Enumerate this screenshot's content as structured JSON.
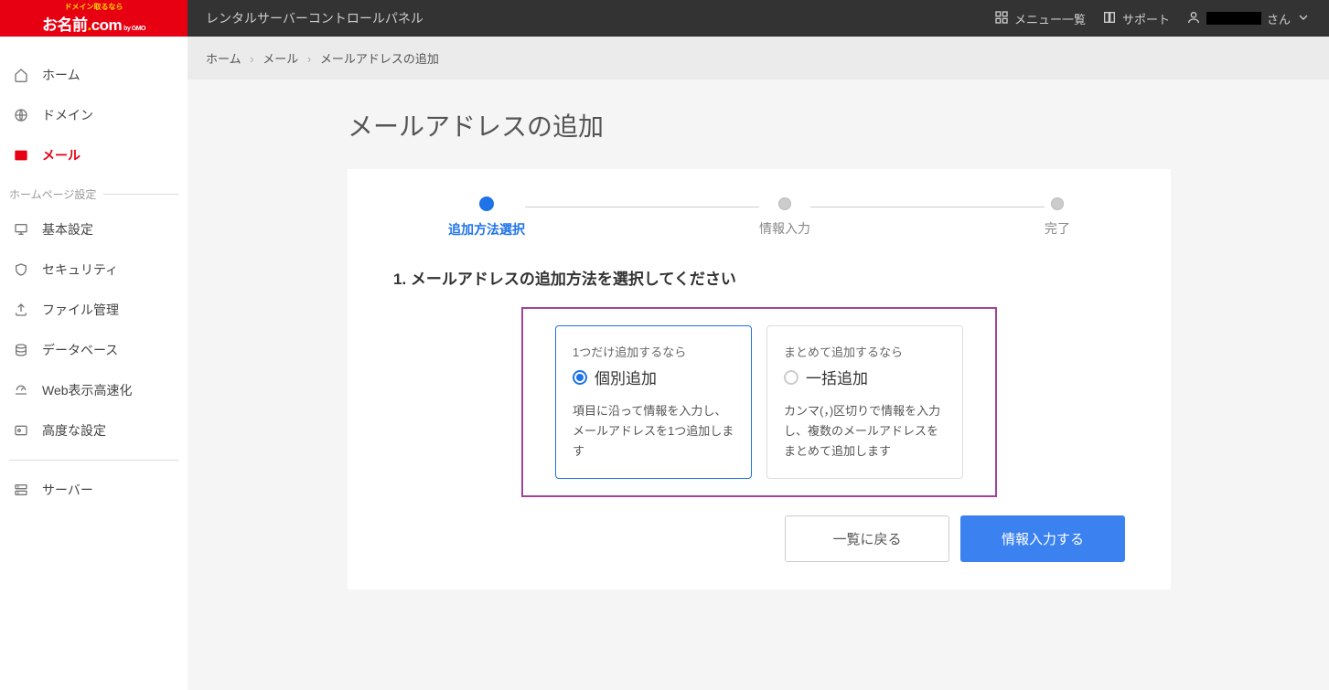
{
  "header": {
    "title": "レンタルサーバーコントロールパネル",
    "menu_list": "メニュー一覧",
    "support": "サポート",
    "user_suffix": "さん"
  },
  "sidebar": {
    "home": "ホーム",
    "domain": "ドメイン",
    "mail": "メール",
    "section_homepage": "ホームページ設定",
    "basic": "基本設定",
    "security": "セキュリティ",
    "file": "ファイル管理",
    "database": "データベース",
    "speed": "Web表示高速化",
    "advanced": "高度な設定",
    "server": "サーバー"
  },
  "breadcrumbs": {
    "home": "ホーム",
    "mail": "メール",
    "current": "メールアドレスの追加"
  },
  "page": {
    "title": "メールアドレスの追加"
  },
  "stepper": {
    "step1": "追加方法選択",
    "step2": "情報入力",
    "step3": "完了"
  },
  "section": {
    "title": "1. メールアドレスの追加方法を選択してください"
  },
  "options": {
    "individual": {
      "subtitle": "1つだけ追加するなら",
      "title": "個別追加",
      "desc": "項目に沿って情報を入力し、メールアドレスを1つ追加します"
    },
    "bulk": {
      "subtitle": "まとめて追加するなら",
      "title": "一括追加",
      "desc": "カンマ(，)区切りで情報を入力し、複数のメールアドレスをまとめて追加します"
    }
  },
  "buttons": {
    "back": "一覧に戻る",
    "next": "情報入力する"
  }
}
